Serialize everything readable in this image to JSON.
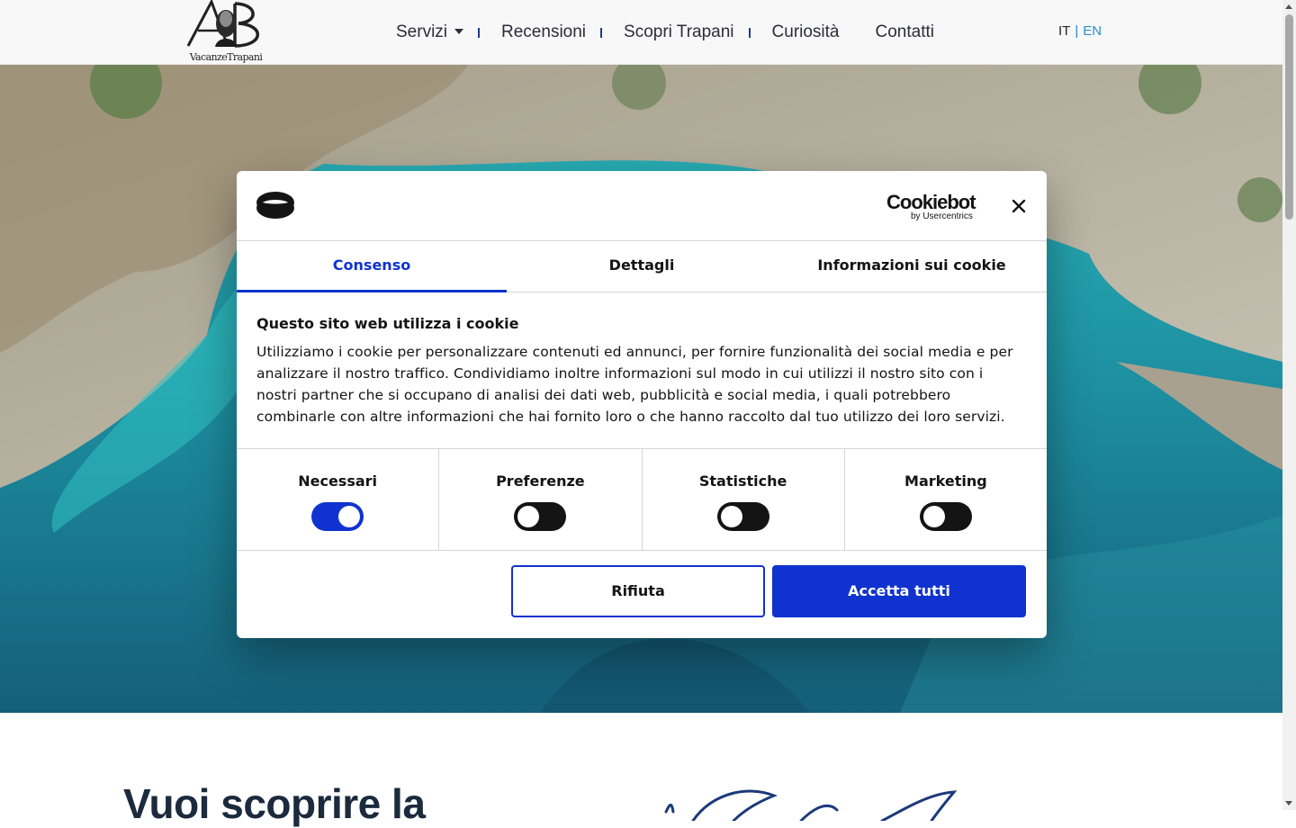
{
  "header": {
    "logo_caption": "VacanzeTrapani",
    "nav": [
      {
        "label": "Servizi"
      },
      {
        "label": "Recensioni"
      },
      {
        "label": "Scopri Trapani"
      },
      {
        "label": "Curiosità"
      },
      {
        "label": "Contatti"
      }
    ],
    "languages": {
      "it": "IT",
      "separator": "|",
      "en": "EN"
    }
  },
  "cookie_dialog": {
    "brand_name": "Cookiebot",
    "brand_sub": "by Usercentrics",
    "tabs": [
      {
        "label": "Consenso",
        "active": true
      },
      {
        "label": "Dettagli",
        "active": false
      },
      {
        "label": "Informazioni sui cookie",
        "active": false
      }
    ],
    "title": "Questo sito web utilizza i cookie",
    "body": "Utilizziamo i cookie per personalizzare contenuti ed annunci, per fornire funzionalità dei social media e per analizzare il nostro traffico. Condividiamo inoltre informazioni sul modo in cui utilizzi il nostro sito con i nostri partner che si occupano di analisi dei dati web, pubblicità e social media, i quali potrebbero combinarle con altre informazioni che hai fornito loro o che hanno raccolto dal tuo utilizzo dei loro servizi.",
    "categories": [
      {
        "label": "Necessari",
        "checked": true
      },
      {
        "label": "Preferenze",
        "checked": false
      },
      {
        "label": "Statistiche",
        "checked": false
      },
      {
        "label": "Marketing",
        "checked": false
      }
    ],
    "buttons": {
      "reject": "Rifiuta",
      "accept": "Accetta tutti"
    },
    "colors": {
      "accent": "#1032cf",
      "text": "#141414"
    }
  },
  "section": {
    "title_partial": "Vuoi scoprire la"
  }
}
